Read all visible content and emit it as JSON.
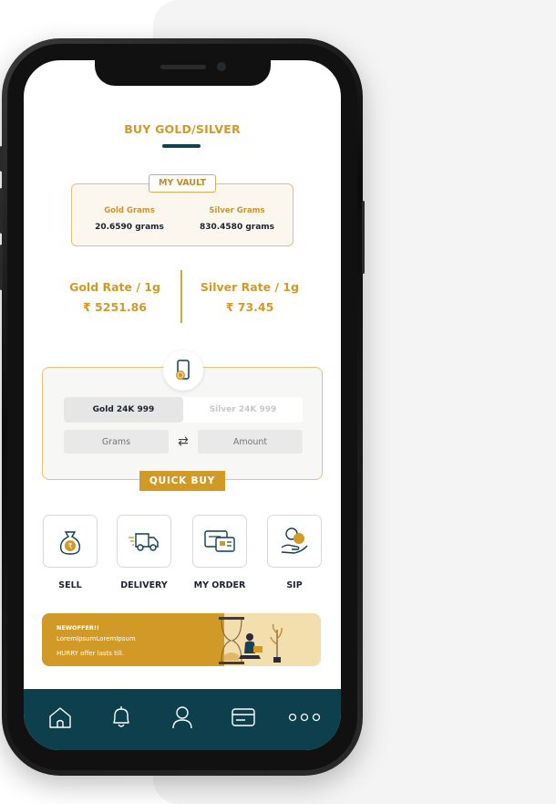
{
  "header": {
    "title": "BUY GOLD/SILVER"
  },
  "vault": {
    "tag": "MY VAULT",
    "gold_label": "Gold Grams",
    "gold_value": "20.6590 grams",
    "silver_label": "Silver Grams",
    "silver_value": "830.4580 grams"
  },
  "rates": {
    "gold_label": "Gold Rate / 1g",
    "gold_value": "₹ 5251.86",
    "silver_label": "Silver Rate / 1g",
    "silver_value": "₹ 73.45"
  },
  "quick_buy": {
    "tabs": [
      {
        "label": "Gold 24K 999",
        "active": true
      },
      {
        "label": "Silver 24K 999",
        "active": false
      }
    ],
    "grams_placeholder": "Grams",
    "amount_placeholder": "Amount",
    "button": "QUICK BUY"
  },
  "actions": [
    {
      "label": "SELL",
      "icon": "money-bag-rupee-icon"
    },
    {
      "label": "DELIVERY",
      "icon": "delivery-truck-icon"
    },
    {
      "label": "MY ORDER",
      "icon": "orders-icon"
    },
    {
      "label": "SIP",
      "icon": "hand-coins-icon"
    }
  ],
  "banner": {
    "title": "NEWOFFER!!",
    "subtitle": "LoremIpsumLoremIpsum",
    "note": "HURRY offer lasts till."
  },
  "bottom_nav": [
    "home-icon",
    "bell-icon",
    "profile-icon",
    "wallet-icon",
    "more-icon"
  ],
  "colors": {
    "gold": "#d19a27",
    "navy": "#0d3f4d",
    "text": "#1c2230"
  }
}
